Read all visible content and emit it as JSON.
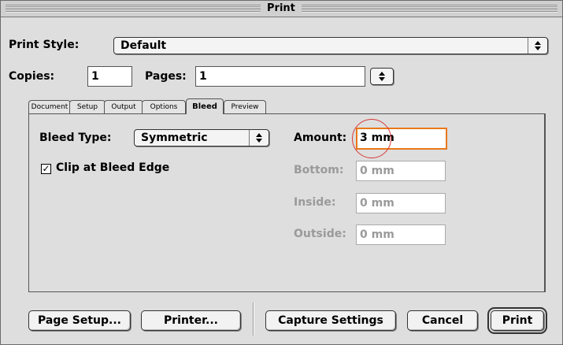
{
  "window": {
    "title": "Print"
  },
  "print_style": {
    "label": "Print Style:",
    "value": "Default"
  },
  "copies": {
    "label": "Copies:",
    "value": "1"
  },
  "pages": {
    "label": "Pages:",
    "value": "1"
  },
  "tabs": [
    {
      "label": "Document",
      "active": false
    },
    {
      "label": "Setup",
      "active": false
    },
    {
      "label": "Output",
      "active": false
    },
    {
      "label": "Options",
      "active": false
    },
    {
      "label": "Bleed",
      "active": true
    },
    {
      "label": "Preview",
      "active": false
    }
  ],
  "bleed": {
    "type_label": "Bleed Type:",
    "type_value": "Symmetric",
    "clip_label": "Clip at Bleed Edge",
    "clip_checked": true,
    "amount_label": "Amount:",
    "amount_value": "3 mm",
    "bottom_label": "Bottom:",
    "bottom_value": "0 mm",
    "inside_label": "Inside:",
    "inside_value": "0 mm",
    "outside_label": "Outside:",
    "outside_value": "0 mm"
  },
  "buttons": {
    "page_setup": "Page Setup...",
    "printer": "Printer...",
    "capture_settings": "Capture Settings",
    "cancel": "Cancel",
    "print": "Print"
  },
  "icons": {
    "updown": "⇕",
    "check": "✓"
  },
  "colors": {
    "focus_ring": "#e8781a",
    "annotation_circle": "#d83a3a"
  }
}
